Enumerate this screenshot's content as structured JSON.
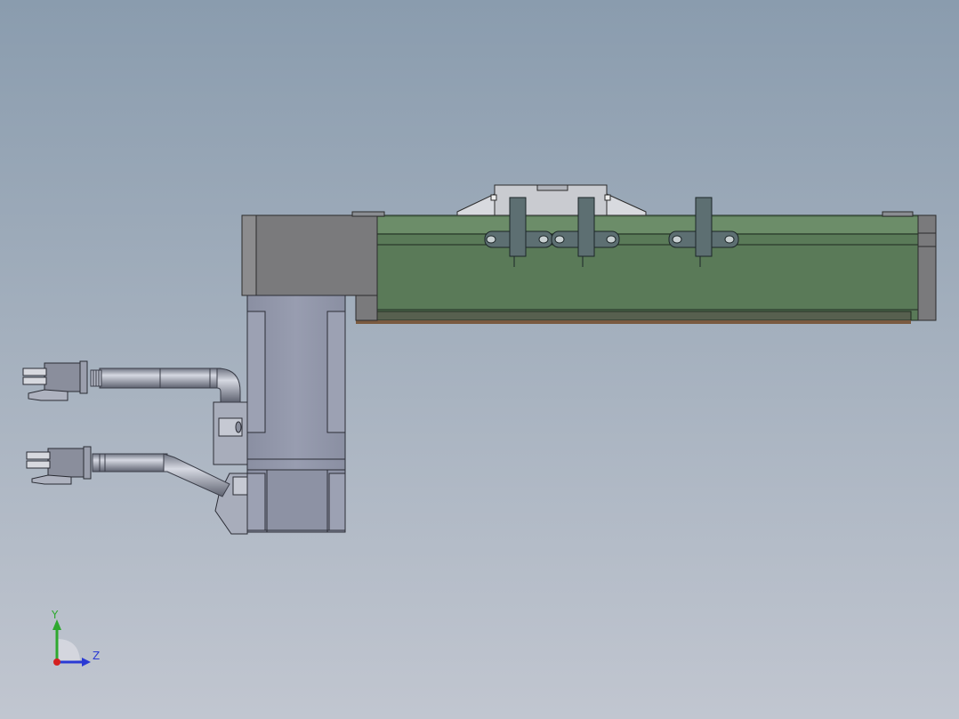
{
  "viewport": {
    "background_top": "#8a9cae",
    "background_bottom": "#c1c6d0"
  },
  "model": {
    "rail_color": "#5a7a58",
    "rail_highlight": "#6c8d69",
    "end_cap_color": "#7a7a7c",
    "motor_color": "#8f94a6",
    "motor_edge": "#2b2d36",
    "cable_color": "#a4a9b8",
    "connector_color": "#8a8e9c",
    "bracket_color": "#5d6f72"
  },
  "triad": {
    "y_label": "Y",
    "z_label": "Z",
    "y_color": "#2ea82e",
    "z_color": "#2a3ad4",
    "x_color": "#d42020"
  }
}
